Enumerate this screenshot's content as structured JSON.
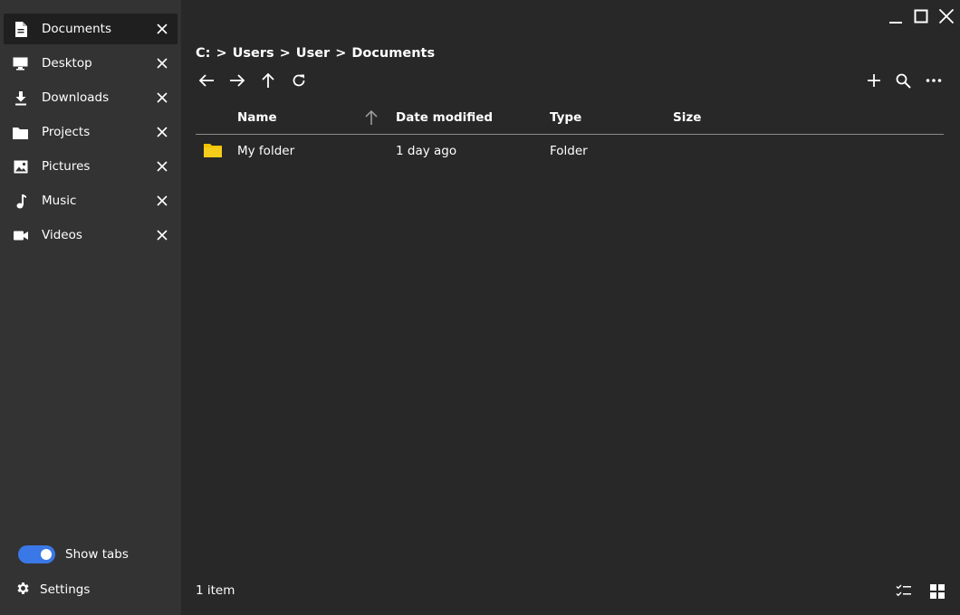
{
  "sidebar": {
    "tabs": [
      {
        "label": "Documents",
        "icon": "document-icon",
        "active": true
      },
      {
        "label": "Desktop",
        "icon": "monitor-icon",
        "active": false
      },
      {
        "label": "Downloads",
        "icon": "download-icon",
        "active": false
      },
      {
        "label": "Projects",
        "icon": "folder-icon",
        "active": false
      },
      {
        "label": "Pictures",
        "icon": "image-icon",
        "active": false
      },
      {
        "label": "Music",
        "icon": "music-note-icon",
        "active": false
      },
      {
        "label": "Videos",
        "icon": "video-camera-icon",
        "active": false
      }
    ],
    "show_tabs_label": "Show tabs",
    "show_tabs_enabled": true,
    "settings_label": "Settings"
  },
  "breadcrumb": {
    "parts": [
      "C:",
      "Users",
      "User",
      "Documents"
    ],
    "separator": ">"
  },
  "table": {
    "columns": [
      "Name",
      "Date modified",
      "Type",
      "Size"
    ],
    "sort_column": "Name",
    "sort_direction": "ascending",
    "rows": [
      {
        "name": "My folder",
        "date_modified": "1 day ago",
        "type": "Folder",
        "size": ""
      }
    ]
  },
  "status": {
    "item_count": "1 item"
  },
  "colors": {
    "background": "#282828",
    "sidebar": "#333333",
    "active_tab": "#1f1f1f",
    "accent": "#3b78e7",
    "folder": "#f0c400"
  }
}
